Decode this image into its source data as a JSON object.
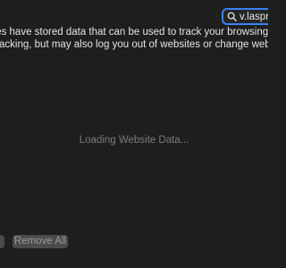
{
  "search": {
    "value": "v.lasprov",
    "icon": "search-icon"
  },
  "description": {
    "line1": "tes have stored data that can be used to track your browsing. Removing",
    "line2": "tracking, but may also log you out of websites or change website behav"
  },
  "status": {
    "loading": "Loading Website Data..."
  },
  "buttons": {
    "remove_label": "",
    "remove_all_label": "Remove All"
  },
  "colors": {
    "background": "#1e1e1e",
    "accent": "#3a82f7",
    "text": "#e4e4e4",
    "muted_text": "#7c7c7c",
    "button_bg": "#4b4b4b"
  }
}
